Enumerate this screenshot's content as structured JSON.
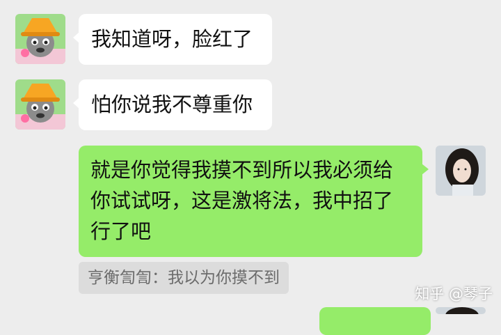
{
  "messages": [
    {
      "sender": "friend",
      "text": "我知道呀，脸红了"
    },
    {
      "sender": "friend",
      "text": "怕你说我不尊重你"
    },
    {
      "sender": "self",
      "lines": [
        "就是你觉得我摸不到所以我必须给",
        "你试试呀，这是激将法，我中招了",
        "行了吧"
      ]
    }
  ],
  "quote": {
    "text": "亨衡訇訇：我以为你摸不到"
  },
  "watermark": {
    "text": "知乎 @琴子"
  },
  "colors": {
    "background": "#ededed",
    "incoming_bubble": "#ffffff",
    "outgoing_bubble": "#95ec69",
    "quote_bg": "#dcdcdc"
  },
  "avatars": {
    "friend": "cartoon-gray-wolf-avatar-icon",
    "self": "girl-photo-avatar"
  }
}
